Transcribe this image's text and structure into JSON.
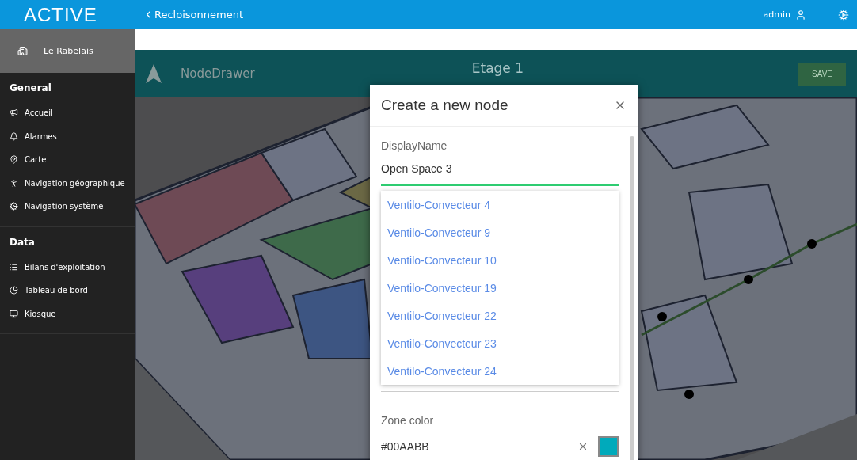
{
  "app": {
    "logo": "ACTIVE"
  },
  "topbar": {
    "back_label": "Recloisonnement",
    "user": "admin"
  },
  "sidebar": {
    "site": "Le Rabelais",
    "sections": [
      {
        "title": "General",
        "items": [
          {
            "label": "Accueil",
            "kind": "megaphone"
          },
          {
            "label": "Alarmes",
            "kind": "bell"
          },
          {
            "label": "Carte",
            "kind": "pin"
          },
          {
            "label": "Navigation géographique",
            "kind": "person"
          },
          {
            "label": "Navigation système",
            "kind": "gears"
          }
        ]
      },
      {
        "title": "Data",
        "items": [
          {
            "label": "Bilans d'exploitation",
            "kind": "list"
          },
          {
            "label": "Tableau de bord",
            "kind": "chart"
          },
          {
            "label": "Kiosque",
            "kind": "monitor"
          }
        ]
      }
    ]
  },
  "editor": {
    "app_name": "NodeDrawer",
    "title": "Etage 1",
    "save_button": "SAVE"
  },
  "dialog": {
    "title": "Create a new node",
    "display_name": {
      "label": "DisplayName",
      "value": "Open Space 3",
      "focused": true
    },
    "options": [
      "Ventilo-Convecteur 4",
      "Ventilo-Convecteur 9",
      "Ventilo-Convecteur 10",
      "Ventilo-Convecteur 19",
      "Ventilo-Convecteur 22",
      "Ventilo-Convecteur 23",
      "Ventilo-Convecteur 24"
    ],
    "zone_color": {
      "label": "Zone color",
      "value": "#00AABB",
      "color": "#00aabb"
    }
  }
}
